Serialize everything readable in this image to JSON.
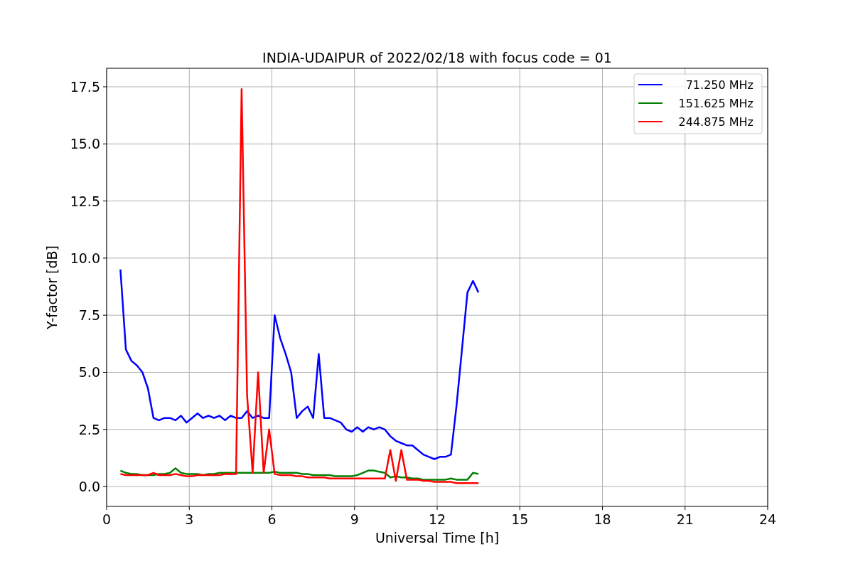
{
  "figure": {
    "chart_data": {
      "type": "line",
      "title": "INDIA-UDAIPUR of 2022/02/18 with focus code = 01",
      "xlabel": "Universal Time [h]",
      "ylabel": "Y-factor [dB]",
      "x": [
        0.5,
        0.7,
        0.9,
        1.1,
        1.3,
        1.5,
        1.7,
        1.9,
        2.1,
        2.3,
        2.5,
        2.7,
        2.9,
        3.1,
        3.3,
        3.5,
        3.7,
        3.9,
        4.1,
        4.3,
        4.5,
        4.7,
        4.9,
        5.1,
        5.3,
        5.5,
        5.7,
        5.9,
        6.1,
        6.3,
        6.5,
        6.7,
        6.9,
        7.1,
        7.3,
        7.5,
        7.7,
        7.9,
        8.1,
        8.3,
        8.5,
        8.7,
        8.9,
        9.1,
        9.3,
        9.5,
        9.7,
        9.9,
        10.1,
        10.3,
        10.5,
        10.7,
        10.9,
        11.1,
        11.3,
        11.5,
        11.7,
        11.9,
        12.1,
        12.3,
        12.5,
        12.7,
        12.9,
        13.1,
        13.3,
        13.5
      ],
      "series": [
        {
          "name": "71.250 MHz",
          "color": "#0000ff",
          "values": [
            9.5,
            6.0,
            5.5,
            5.3,
            5.0,
            4.3,
            3.0,
            2.9,
            3.0,
            3.0,
            2.9,
            3.1,
            2.8,
            3.0,
            3.2,
            3.0,
            3.1,
            3.0,
            3.1,
            2.9,
            3.1,
            3.0,
            3.0,
            3.3,
            3.0,
            3.1,
            3.0,
            3.0,
            7.5,
            6.5,
            5.8,
            5.0,
            3.0,
            3.3,
            3.5,
            3.0,
            5.8,
            3.0,
            3.0,
            2.9,
            2.8,
            2.5,
            2.4,
            2.6,
            2.4,
            2.6,
            2.5,
            2.6,
            2.5,
            2.2,
            2.0,
            1.9,
            1.8,
            1.8,
            1.6,
            1.4,
            1.3,
            1.2,
            1.3,
            1.3,
            1.4,
            3.5,
            6.0,
            8.5,
            9.0,
            8.5
          ]
        },
        {
          "name": "151.625 MHz",
          "color": "#008000",
          "values": [
            0.7,
            0.6,
            0.55,
            0.55,
            0.5,
            0.5,
            0.5,
            0.55,
            0.55,
            0.6,
            0.8,
            0.6,
            0.55,
            0.55,
            0.55,
            0.5,
            0.55,
            0.55,
            0.6,
            0.6,
            0.6,
            0.6,
            0.6,
            0.6,
            0.6,
            0.6,
            0.6,
            0.6,
            0.65,
            0.6,
            0.6,
            0.6,
            0.6,
            0.55,
            0.55,
            0.5,
            0.5,
            0.5,
            0.5,
            0.45,
            0.45,
            0.45,
            0.45,
            0.5,
            0.6,
            0.7,
            0.7,
            0.65,
            0.6,
            0.4,
            0.45,
            0.4,
            0.4,
            0.35,
            0.35,
            0.3,
            0.3,
            0.3,
            0.3,
            0.3,
            0.35,
            0.3,
            0.3,
            0.3,
            0.6,
            0.55
          ]
        },
        {
          "name": "244.875 MHz",
          "color": "#ff0000",
          "values": [
            0.55,
            0.5,
            0.5,
            0.5,
            0.5,
            0.5,
            0.6,
            0.5,
            0.5,
            0.5,
            0.55,
            0.5,
            0.45,
            0.45,
            0.5,
            0.5,
            0.5,
            0.5,
            0.5,
            0.55,
            0.55,
            0.55,
            17.4,
            4.0,
            0.6,
            5.0,
            0.6,
            2.5,
            0.55,
            0.5,
            0.5,
            0.5,
            0.45,
            0.45,
            0.4,
            0.4,
            0.4,
            0.4,
            0.35,
            0.35,
            0.35,
            0.35,
            0.35,
            0.35,
            0.35,
            0.35,
            0.35,
            0.35,
            0.35,
            1.6,
            0.25,
            1.6,
            0.3,
            0.3,
            0.3,
            0.25,
            0.25,
            0.2,
            0.2,
            0.2,
            0.2,
            0.15,
            0.15,
            0.15,
            0.15,
            0.15
          ]
        }
      ],
      "grid": true,
      "legend": true,
      "xlim": [
        0,
        24
      ],
      "ylim": [
        -0.87,
        18.31
      ],
      "xticks": [
        0,
        3,
        6,
        9,
        12,
        15,
        18,
        21,
        24
      ],
      "yticks": [
        {
          "value": 0,
          "label": "0.0"
        },
        {
          "value": 2.5,
          "label": "2.5"
        },
        {
          "value": 5,
          "label": "5.0"
        },
        {
          "value": 7.5,
          "label": "7.5"
        },
        {
          "value": 10,
          "label": "10.0"
        },
        {
          "value": 12.5,
          "label": "12.5"
        },
        {
          "value": 15,
          "label": "15.0"
        },
        {
          "value": 17.5,
          "label": "17.5"
        }
      ]
    }
  }
}
